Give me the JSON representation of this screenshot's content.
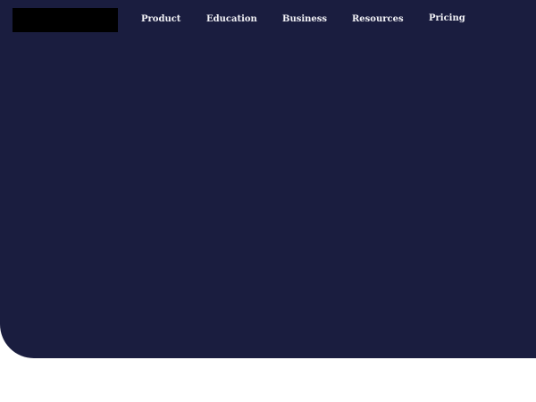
{
  "nav": {
    "items": [
      {
        "label": "Product"
      },
      {
        "label": "Education"
      },
      {
        "label": "Business"
      },
      {
        "label": "Resources"
      },
      {
        "label": "Pricing"
      }
    ]
  },
  "colors": {
    "hero_background": "#1a1d3f",
    "nav_text": "#f2f2f6",
    "logo_block": "#000000",
    "page_background": "#ffffff"
  }
}
